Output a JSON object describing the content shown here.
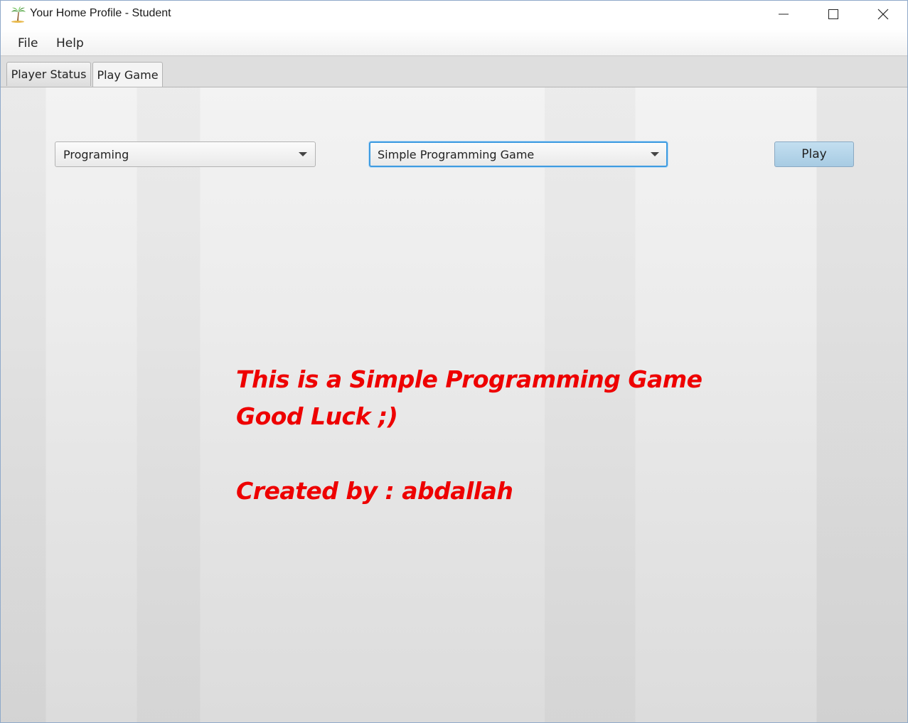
{
  "window": {
    "title": "Your Home Profile - Student",
    "icon": "palm-tree-icon"
  },
  "menu": {
    "items": [
      {
        "label": "File"
      },
      {
        "label": "Help"
      }
    ]
  },
  "tabs": [
    {
      "label": "Player Status",
      "selected": false
    },
    {
      "label": "Play Game",
      "selected": true
    }
  ],
  "form": {
    "category_select": {
      "value": "Programing"
    },
    "game_select": {
      "value": "Simple Programming Game",
      "focused": true
    },
    "play_label": "Play"
  },
  "message": {
    "line1": "This is a Simple Programming Game",
    "line2": "Good Luck ;)",
    "line3": "Created by : abdallah"
  },
  "colors": {
    "message_text": "#ee0000",
    "focus_ring": "#3e9be0",
    "play_button": "#a7cbe3"
  }
}
